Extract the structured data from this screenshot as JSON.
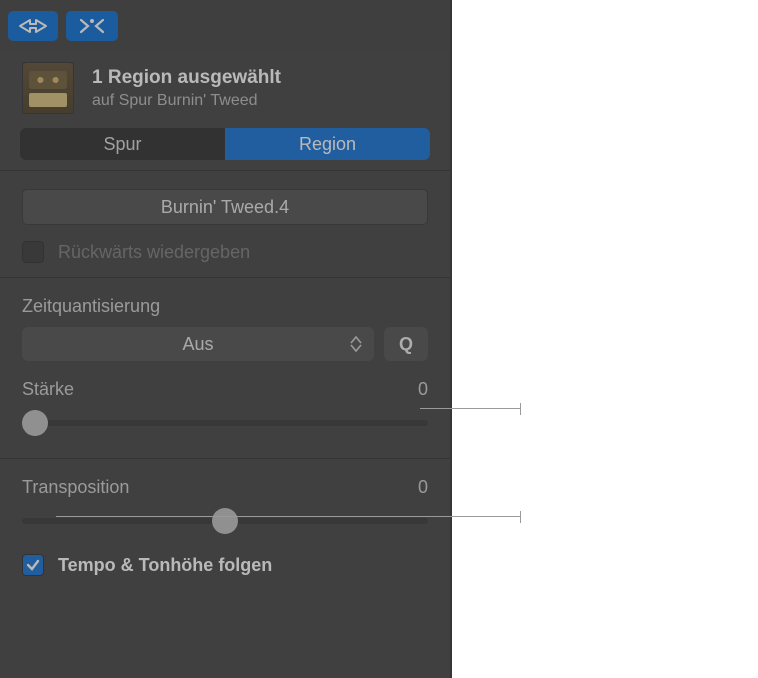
{
  "header": {
    "title": "1 Region ausgewählt",
    "subtitle": "auf Spur Burnin' Tweed"
  },
  "tabs": {
    "spur": "Spur",
    "region": "Region"
  },
  "region_name": "Burnin' Tweed.4",
  "reverse": {
    "label": "Rückwärts wiedergeben"
  },
  "quantize": {
    "title": "Zeitquantisierung",
    "value": "Aus",
    "q_button": "Q",
    "strength_label": "Stärke",
    "strength_value": "0"
  },
  "transpose": {
    "label": "Transposition",
    "value": "0"
  },
  "follow": {
    "label": "Tempo & Tonhöhe folgen"
  }
}
